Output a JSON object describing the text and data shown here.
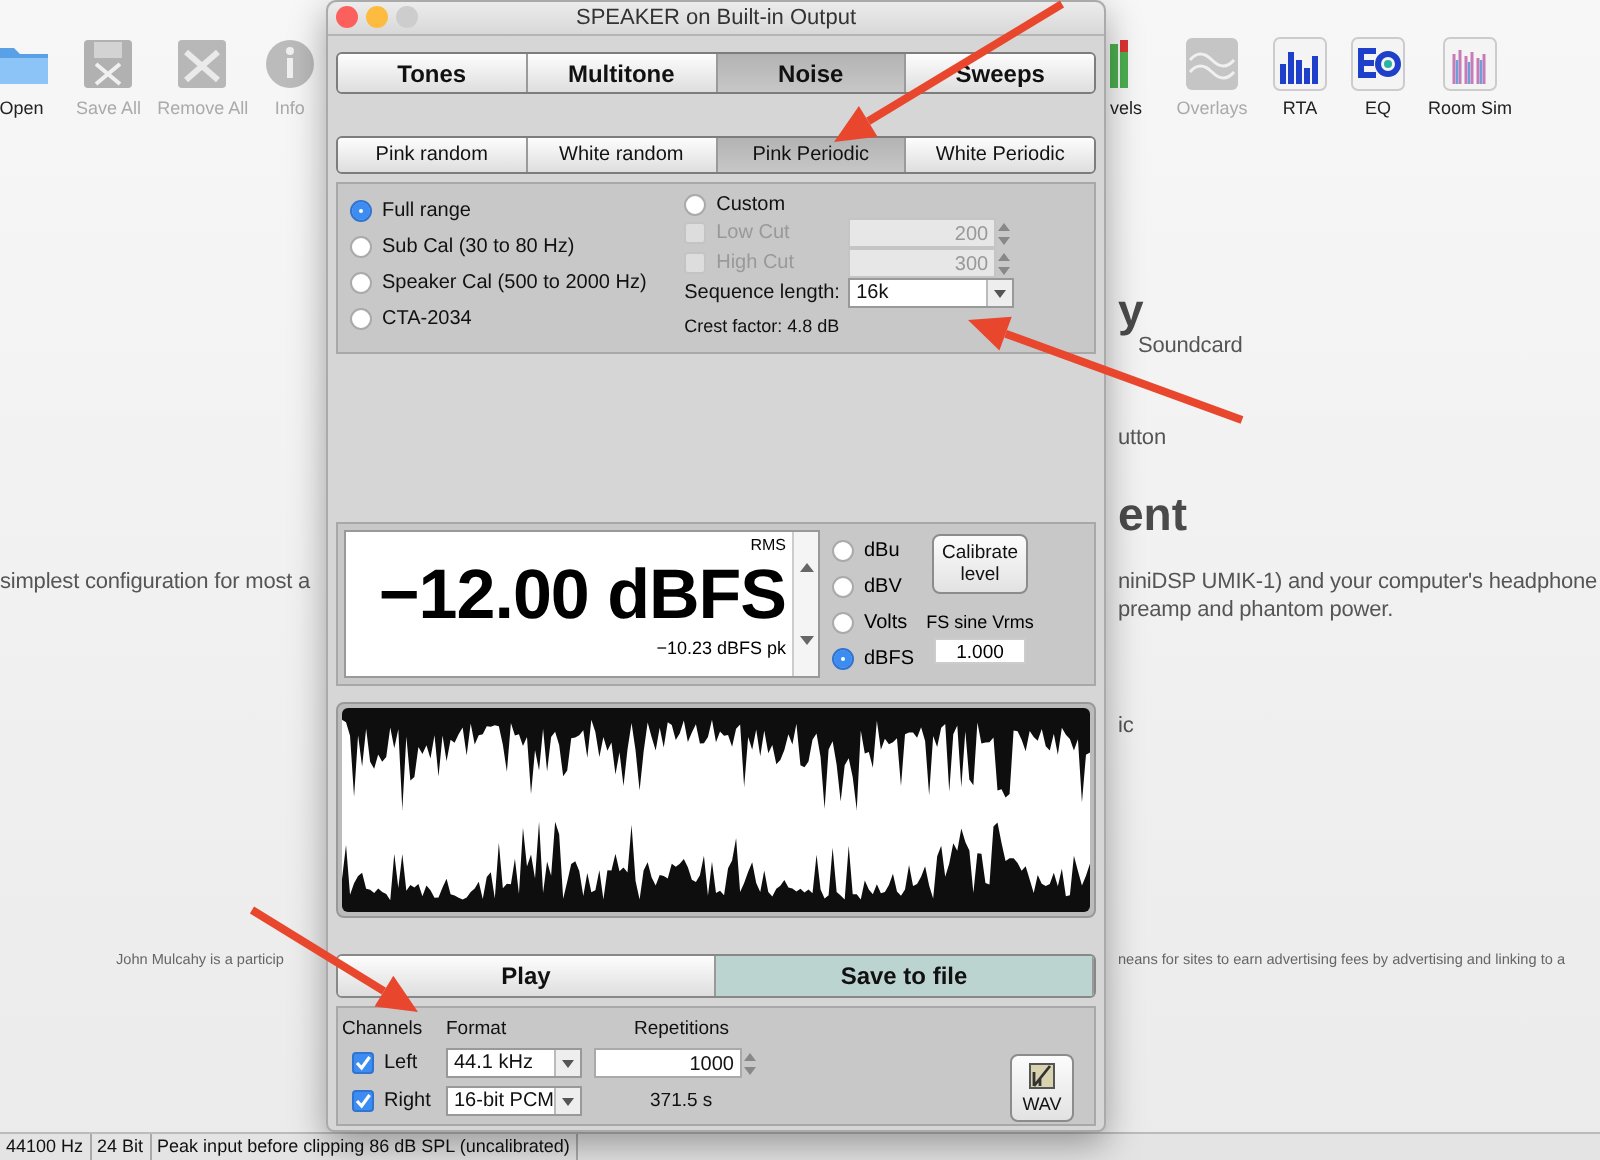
{
  "toolbar_left": [
    {
      "label": "Open",
      "kind": "folder",
      "disabled": false
    },
    {
      "label": "Save All",
      "kind": "save",
      "disabled": true
    },
    {
      "label": "Remove All",
      "kind": "remove",
      "disabled": true
    },
    {
      "label": "Info",
      "kind": "info",
      "disabled": true
    }
  ],
  "toolbar_right": [
    {
      "label": "vels",
      "kind": "levels",
      "disabled": false
    },
    {
      "label": "Overlays",
      "kind": "overlays",
      "disabled": true
    },
    {
      "label": "RTA",
      "kind": "rta",
      "disabled": false
    },
    {
      "label": "EQ",
      "kind": "eq",
      "disabled": false
    },
    {
      "label": "Room Sim",
      "kind": "roomsim",
      "disabled": false
    }
  ],
  "page_left": [
    {
      "kind": "body",
      "text": "simplest configuration for most a"
    },
    {
      "kind": "small",
      "text": "John Mulcahy is a particip"
    }
  ],
  "page_right": [
    {
      "kind": "heading",
      "text": "y"
    },
    {
      "kind": "body",
      "text": "Soundcard"
    },
    {
      "kind": "body",
      "text": "utton"
    },
    {
      "kind": "heading",
      "text": "ent"
    },
    {
      "kind": "body",
      "text": "niniDSP UMIK-1) and your computer's headphone"
    },
    {
      "kind": "body",
      "text": "preamp and phantom power."
    },
    {
      "kind": "body",
      "text": "ic"
    },
    {
      "kind": "small",
      "text": "neans for sites to earn advertising fees by advertising and linking to a"
    }
  ],
  "status_bar": [
    "44100 Hz",
    "24 Bit",
    "Peak input before clipping 86 dB SPL (uncalibrated)"
  ],
  "dialog": {
    "title": "SPEAKER on Built-in Output",
    "tabs": [
      {
        "label": "Tones",
        "selected": false
      },
      {
        "label": "Multitone",
        "selected": false
      },
      {
        "label": "Noise",
        "selected": true
      },
      {
        "label": "Sweeps",
        "selected": false
      }
    ],
    "noise_tabs": [
      {
        "label": "Pink random",
        "selected": false
      },
      {
        "label": "White random",
        "selected": false
      },
      {
        "label": "Pink Periodic",
        "selected": true
      },
      {
        "label": "White Periodic",
        "selected": false
      }
    ],
    "range_options": [
      {
        "label": "Full range",
        "selected": true
      },
      {
        "label": "Sub Cal (30 to 80 Hz)",
        "selected": false
      },
      {
        "label": "Speaker Cal (500 to 2000 Hz)",
        "selected": false
      },
      {
        "label": "CTA-2034",
        "selected": false
      },
      {
        "label": "Custom",
        "selected": false
      }
    ],
    "cuts": [
      {
        "label": "Low Cut",
        "checked": false,
        "disabled": true,
        "value": "200"
      },
      {
        "label": "High Cut",
        "checked": false,
        "disabled": true,
        "value": "300"
      }
    ],
    "sequence_length": {
      "label": "Sequence length:",
      "value": "16k"
    },
    "crest_factor": "Crest factor: 4.8 dB",
    "meter": {
      "mode": "RMS",
      "reading": "−12.00 dBFS",
      "peak": "−10.23 dBFS pk"
    },
    "units": [
      {
        "label": "dBu",
        "selected": false
      },
      {
        "label": "dBV",
        "selected": false
      },
      {
        "label": "Volts",
        "selected": false
      },
      {
        "label": "dBFS",
        "selected": true
      }
    ],
    "calibrate_button": "Calibrate level",
    "fs_label": "FS sine Vrms",
    "fs_value": "1.000",
    "actions": [
      {
        "label": "Play",
        "selected": false
      },
      {
        "label": "Save to file",
        "selected": true
      }
    ],
    "output": {
      "headers": [
        "Channels",
        "Format",
        "Repetitions"
      ],
      "channels": [
        {
          "label": "Left",
          "checked": true
        },
        {
          "label": "Right",
          "checked": true
        }
      ],
      "formats": [
        "44.1 kHz",
        "16-bit PCM"
      ],
      "repetitions": "1000",
      "duration": "371.5 s",
      "wav_button": "WAV"
    }
  }
}
